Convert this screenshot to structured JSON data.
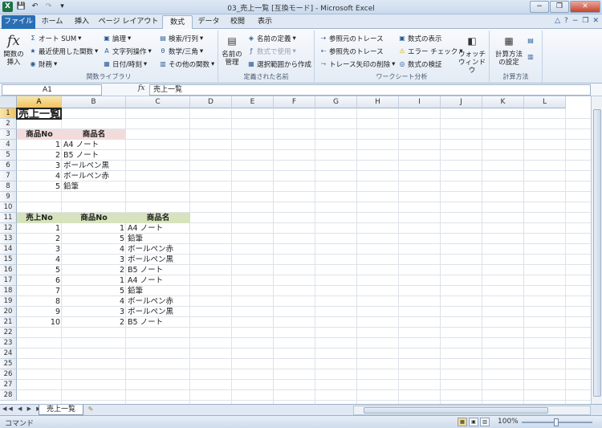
{
  "window": {
    "title": "03_売上一覧 [互換モード] - Microsoft Excel",
    "buttons": {
      "min": "−",
      "max": "❐",
      "close": "✕"
    }
  },
  "tabs": [
    {
      "label": "ファイル"
    },
    {
      "label": "ホーム"
    },
    {
      "label": "挿入"
    },
    {
      "label": "ページ レイアウト"
    },
    {
      "label": "数式"
    },
    {
      "label": "データ"
    },
    {
      "label": "校閲"
    },
    {
      "label": "表示"
    }
  ],
  "ribbon": {
    "function_library": {
      "insert_function": "関数の挿入",
      "autosum": "オート SUM",
      "recent": "最近使用した関数",
      "financial": "財務",
      "logical": "論理",
      "text": "文字列操作",
      "datetime": "日付/時刻",
      "lookup": "検索/行列",
      "math": "数学/三角",
      "more": "その他の関数",
      "label": "関数ライブラリ"
    },
    "defined_names": {
      "name_manager": "名前の管理",
      "define_name": "名前の定義",
      "use_in_formula": "数式で使用",
      "create_from_selection": "選択範囲から作成",
      "label": "定義された名前"
    },
    "formula_auditing": {
      "trace_precedents": "参照元のトレース",
      "trace_dependents": "参照先のトレース",
      "remove_arrows": "トレース矢印の削除",
      "show_formulas": "数式の表示",
      "error_checking": "エラー チェック",
      "evaluate": "数式の検証",
      "watch_window": "ウォッチ ウィンドウ",
      "label": "ワークシート分析"
    },
    "calculation": {
      "options": "計算方法の設定",
      "label": "計算方法"
    }
  },
  "formula_bar": {
    "name_box": "A1",
    "fx": "fx",
    "content": "売上一覧"
  },
  "columns": [
    "A",
    "B",
    "C",
    "D",
    "E",
    "F",
    "G",
    "H",
    "I",
    "J",
    "K",
    "L"
  ],
  "rows": [
    "1",
    "2",
    "3",
    "4",
    "5",
    "6",
    "7",
    "8",
    "9",
    "10",
    "11",
    "12",
    "13",
    "14",
    "15",
    "16",
    "17",
    "18",
    "19",
    "20",
    "21",
    "22",
    "23",
    "24",
    "25",
    "26",
    "27",
    "28"
  ],
  "sheet": {
    "title": "売上一覧",
    "table1": {
      "headers": [
        "商品No",
        "商品名"
      ],
      "rows": [
        [
          "1",
          "A4 ノート"
        ],
        [
          "2",
          "B5 ノート"
        ],
        [
          "3",
          "ボールペン黒"
        ],
        [
          "4",
          "ボールペン赤"
        ],
        [
          "5",
          "鉛筆"
        ]
      ]
    },
    "table2": {
      "headers": [
        "売上No",
        "商品No",
        "商品名"
      ],
      "rows": [
        [
          "1",
          "1",
          "A4 ノート"
        ],
        [
          "2",
          "5",
          "鉛筆"
        ],
        [
          "3",
          "4",
          "ボールペン赤"
        ],
        [
          "4",
          "3",
          "ボールペン黒"
        ],
        [
          "5",
          "2",
          "B5 ノート"
        ],
        [
          "6",
          "1",
          "A4 ノート"
        ],
        [
          "7",
          "5",
          "鉛筆"
        ],
        [
          "8",
          "4",
          "ボールペン赤"
        ],
        [
          "9",
          "3",
          "ボールペン黒"
        ],
        [
          "10",
          "2",
          "B5 ノート"
        ]
      ]
    }
  },
  "sheet_tabs": [
    {
      "label": "売上一覧"
    }
  ],
  "status": {
    "mode": "コマンド",
    "zoom": "100%"
  },
  "colors": {
    "file_tab": "#2a6fb5",
    "header_pink": "#f2dcdb",
    "header_green": "#d6e3bc"
  }
}
